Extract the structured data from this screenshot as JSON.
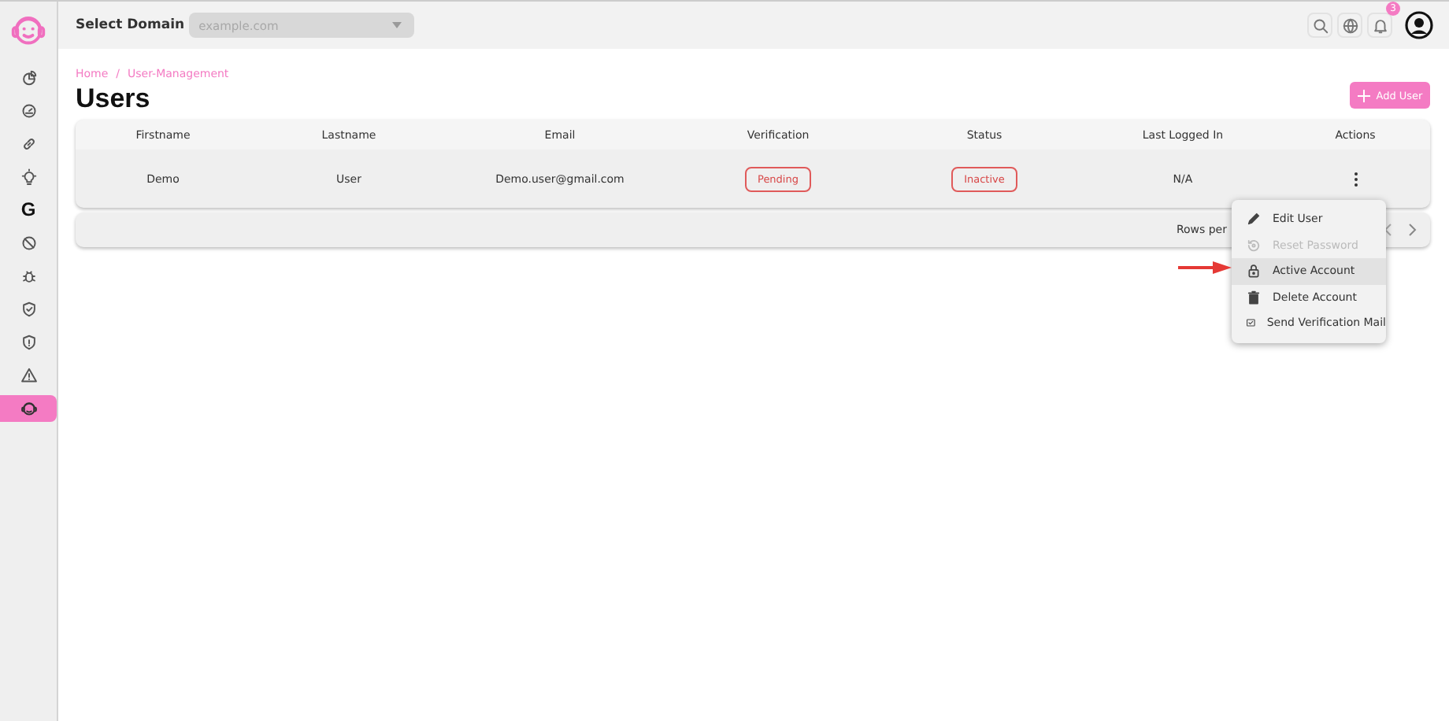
{
  "sidebar": {
    "items": [
      {
        "kind": "chart",
        "selected": false
      },
      {
        "kind": "gauge",
        "selected": false
      },
      {
        "kind": "link",
        "selected": false
      },
      {
        "kind": "bulb",
        "selected": false
      },
      {
        "kind": "letter",
        "label": "G",
        "selected": false
      },
      {
        "kind": "block",
        "selected": false
      },
      {
        "kind": "bug",
        "selected": false
      },
      {
        "kind": "shield-check",
        "selected": false
      },
      {
        "kind": "shield",
        "selected": false
      },
      {
        "kind": "warning",
        "selected": false
      },
      {
        "kind": "face",
        "selected": true
      }
    ]
  },
  "topbar": {
    "domain_label": "Select Domain",
    "domain_select": {
      "placeholder": "example.com"
    },
    "notifications": "3"
  },
  "breadcrumb": {
    "items": [
      "Home",
      "User-Management"
    ],
    "separator": "/"
  },
  "page_title": "Users",
  "add_button": "Add User",
  "table": {
    "columns": [
      "Firstname",
      "Lastname",
      "Email",
      "Verification",
      "Status",
      "Last Logged In",
      "Actions"
    ],
    "rows": [
      {
        "firstname": "Demo",
        "lastname": "User",
        "email": "Demo.user@gmail.com",
        "verification": "Pending",
        "status": "Inactive",
        "last_logged_in": "N/A"
      }
    ],
    "footer": {
      "rows_per_page": "Rows per"
    }
  },
  "action_menu": {
    "items": [
      {
        "kind": "pencil",
        "label": "Edit User",
        "disabled": false,
        "selected": false
      },
      {
        "kind": "reset",
        "label": "Reset Password",
        "disabled": true,
        "selected": false
      },
      {
        "kind": "lock",
        "label": "Active Account",
        "disabled": false,
        "selected": true
      },
      {
        "kind": "trash",
        "label": "Delete Account",
        "disabled": false,
        "selected": false
      },
      {
        "kind": "mail-check",
        "label": "Send Verification Mail",
        "disabled": false,
        "selected": false
      }
    ]
  },
  "annotation": {
    "kind": "arrow"
  }
}
